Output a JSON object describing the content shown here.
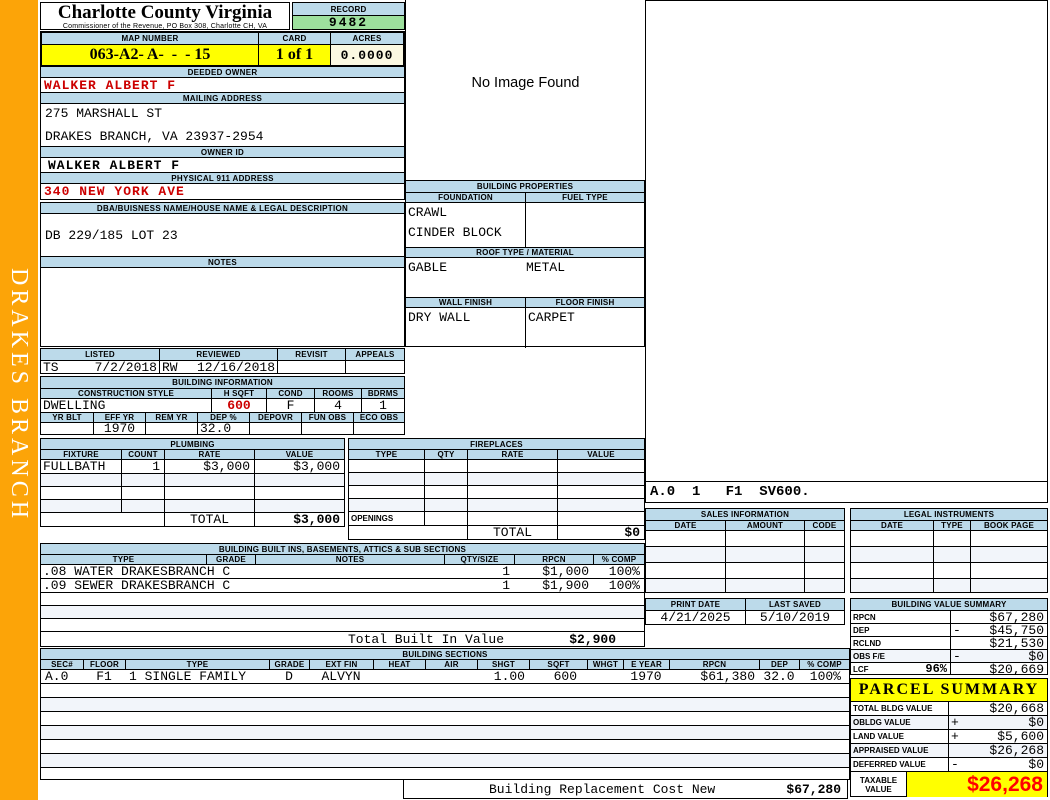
{
  "sidebar": {
    "district": "DRAKES BRANCH"
  },
  "header": {
    "county": "Charlotte County Virginia",
    "commissioner": "Commissioner of the Revenue, PO Box 308, Charlotte CH, VA",
    "record_label": "RECORD",
    "record_value": "9482",
    "map_number_label": "MAP NUMBER",
    "map_number": "063-A2- A-  -  - 15",
    "card_label": "CARD",
    "card_value": "1 of 1",
    "acres_label": "ACRES",
    "acres_value": "0.0000"
  },
  "owner": {
    "deeded_owner_label": "DEEDED OWNER",
    "deeded_owner": "WALKER ALBERT F",
    "mailing_address_label": "MAILING ADDRESS",
    "mailing_line1": "275 MARSHALL ST",
    "mailing_line2": "DRAKES BRANCH, VA 23937-2954",
    "owner_id_label": "OWNER ID",
    "owner_id": "WALKER ALBERT F",
    "physical_address_label": "PHYSICAL 911 ADDRESS",
    "physical_address": "340 NEW YORK AVE",
    "dba_label": "DBA/BUISNESS NAME/HOUSE NAME & LEGAL DESCRIPTION",
    "legal_description": "DB 229/185 LOT 23",
    "notes_label": "NOTES",
    "notes": ""
  },
  "review": {
    "listed_label": "LISTED",
    "listed_by": "TS",
    "listed_date": "7/2/2018",
    "reviewed_label": "REVIEWED",
    "reviewed_by": "RW",
    "reviewed_date": "12/16/2018",
    "revisit_label": "REVISIT",
    "appeals_label": "APPEALS"
  },
  "building_info": {
    "title": "BUILDING INFORMATION",
    "style_label": "CONSTRUCTION STYLE",
    "style": "DWELLING",
    "hsqft_label": "H SQFT",
    "hsqft": "600",
    "cond_label": "COND",
    "cond": "F",
    "rooms_label": "ROOMS",
    "rooms": "4",
    "bdrms_label": "BDRMS",
    "bdrms": "1",
    "yrblt_label": "YR BLT",
    "yrblt": "",
    "effyr_label": "EFF YR",
    "effyr": "1970",
    "remyr_label": "REM YR",
    "remyr": "",
    "dep_label": "DEP %",
    "dep": "32.0",
    "depovr_label": "DEPOVR",
    "funobs_label": "FUN OBS",
    "ecoobs_label": "ECO OBS"
  },
  "image_panel": {
    "message": "No Image Found"
  },
  "building_properties": {
    "title": "BUILDING PROPERTIES",
    "foundation_label": "FOUNDATION",
    "foundation_line1": "CRAWL",
    "foundation_line2": "CINDER BLOCK",
    "fuel_label": "FUEL TYPE",
    "fuel": "",
    "roof_label": "ROOF TYPE / MATERIAL",
    "roof_type": "GABLE",
    "roof_material": "METAL",
    "wall_label": "WALL FINISH",
    "wall_finish": "DRY WALL",
    "floor_label": "FLOOR FINISH",
    "floor_finish": "CARPET"
  },
  "plumbing": {
    "title": "PLUMBING",
    "headers": [
      "FIXTURE",
      "COUNT",
      "RATE",
      "VALUE"
    ],
    "rows": [
      {
        "fixture": "FULLBATH",
        "count": "1",
        "rate": "$3,000",
        "value": "$3,000"
      }
    ],
    "total_label": "TOTAL",
    "total_value": "$3,000"
  },
  "fireplaces": {
    "title": "FIREPLACES",
    "headers": [
      "TYPE",
      "QTY",
      "RATE",
      "VALUE"
    ],
    "openings_label": "OPENINGS",
    "total_label": "TOTAL",
    "total_value": "$0"
  },
  "built_ins": {
    "title": "BUILDING BUILT INS, BASEMENTS, ATTICS & SUB SECTIONS",
    "headers": [
      "TYPE",
      "GRADE",
      "NOTES",
      "QTY/SIZE",
      "RPCN",
      "% COMP"
    ],
    "rows": [
      {
        "type": ".08 WATER DRAKESBRANCH C",
        "grade": "",
        "notes": "",
        "qty": "1",
        "rpcn": "$1,000",
        "comp": "100%"
      },
      {
        "type": ".09 SEWER DRAKESBRANCH C",
        "grade": "",
        "notes": "",
        "qty": "1",
        "rpcn": "$1,900",
        "comp": "100%"
      }
    ],
    "total_label": "Total Built In Value",
    "total_value": "$2,900"
  },
  "building_sections": {
    "title": "BUILDING SECTIONS",
    "headers": [
      "SEC#",
      "FLOOR",
      "TYPE",
      "GRADE",
      "EXT FIN",
      "HEAT",
      "AIR",
      "SHGT",
      "SQFT",
      "WHGT",
      "E YEAR",
      "RPCN",
      "DEP",
      "% COMP"
    ],
    "rows": [
      {
        "sec": "A.0",
        "floor": "F1",
        "type": "1 SINGLE FAMILY",
        "grade": "D",
        "extfin": "ALVYN",
        "heat": "",
        "air": "",
        "shgt": "1.00",
        "sqft": "600",
        "whgt": "",
        "eyear": "1970",
        "rpcn": "$61,380",
        "dep": "32.0",
        "comp": "100%"
      }
    ]
  },
  "sketch": {
    "label": "A.0  1   F1  SV600."
  },
  "sales": {
    "title": "SALES INFORMATION",
    "headers": [
      "DATE",
      "AMOUNT",
      "CODE"
    ]
  },
  "legal": {
    "title": "LEGAL INSTRUMENTS",
    "headers": [
      "DATE",
      "TYPE",
      "BOOK PAGE"
    ]
  },
  "dates": {
    "print_date_label": "PRINT DATE",
    "print_date": "4/21/2025",
    "last_saved_label": "LAST SAVED",
    "last_saved": "5/10/2019"
  },
  "building_value_summary": {
    "title": "BUILDING VALUE SUMMARY",
    "rows": [
      {
        "label": "RPCN",
        "pct": "",
        "op": "",
        "value": "$67,280"
      },
      {
        "label": "DEP",
        "pct": "",
        "op": "-",
        "value": "$45,750"
      },
      {
        "label": "RCLND",
        "pct": "",
        "op": "",
        "value": "$21,530"
      },
      {
        "label": "OBS F/E",
        "pct": "",
        "op": "-",
        "value": "$0"
      },
      {
        "label": "LCF",
        "pct": "96%",
        "op": "",
        "value": "$20,669"
      }
    ]
  },
  "parcel_summary": {
    "title": "PARCEL SUMMARY",
    "rows": [
      {
        "label": "TOTAL BLDG VALUE",
        "op": "",
        "value": "$20,668"
      },
      {
        "label": "OBLDG VALUE",
        "op": "+",
        "value": "$0"
      },
      {
        "label": "LAND VALUE",
        "op": "+",
        "value": "$5,600"
      },
      {
        "label": "APPRAISED VALUE",
        "op": "",
        "value": "$26,268"
      },
      {
        "label": "DEFERRED VALUE",
        "op": "-",
        "value": "$0"
      }
    ],
    "taxable_label": "TAXABLE VALUE",
    "taxable_value": "$26,268"
  },
  "footer": {
    "label": "Building Replacement Cost New",
    "value": "$67,280"
  },
  "colors": {
    "accent_blue": "#BCDAEA",
    "record_green": "#9DE09D",
    "highlight_yellow": "#FFFF00",
    "acres_cream": "#FBF8E1",
    "sidebar_orange": "#FCA408",
    "alert_red": "#CC0000",
    "taxable_red": "#FF0000"
  }
}
